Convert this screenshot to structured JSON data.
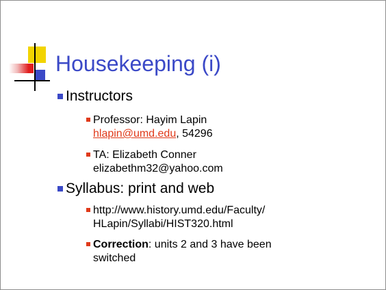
{
  "slide": {
    "title": "Housekeeping (i)",
    "instructors": {
      "heading": "Instructors",
      "professor": {
        "label": "Professor: Hayim Lapin",
        "email": "hlapin@umd.edu",
        "phone": ", 54296"
      },
      "ta": {
        "label": "TA: Elizabeth Conner",
        "email": "elizabethm32@yahoo.com"
      }
    },
    "syllabus": {
      "heading": "Syllabus: print and web",
      "url_line1": "http://www.history.umd.edu/Faculty/",
      "url_line2": "HLapin/Syllabi/HIST320.html",
      "correction_label": "Correction",
      "correction_text": ": units 2 and 3 have been",
      "correction_text2": "switched"
    }
  },
  "colors": {
    "title": "#3b49c7",
    "level1_bullet": "#3b49c7",
    "level2_bullet": "#e03a1a",
    "link": "#e03a1a",
    "logo_yellow": "#f2d400",
    "logo_red": "#e11d1d",
    "logo_blue": "#3b49c7"
  }
}
